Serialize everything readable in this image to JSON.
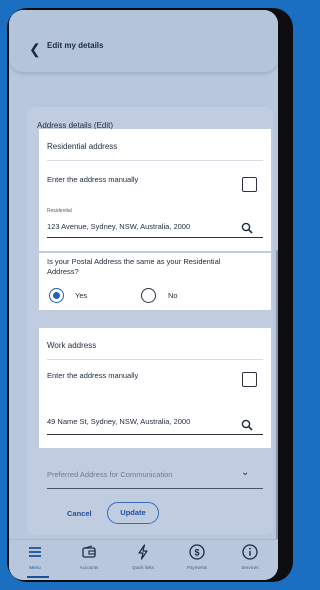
{
  "header": {
    "back_icon": "chevron-left-icon",
    "title": "Edit my details"
  },
  "section_title": "Address details (Edit)",
  "residential": {
    "title": "Residential address",
    "manual_label": "Enter the address manually",
    "field_label": "Residential",
    "value": "123 Avenue, Sydney, NSW, Australia, 2000"
  },
  "postal": {
    "question": "Is your Postal Address the same as your Residential Address?",
    "yes": "Yes",
    "no": "No",
    "selected": "Yes"
  },
  "work": {
    "title": "Work address",
    "manual_label": "Enter the address manually",
    "value": "49 Name St, Sydney, NSW, Australia, 2000"
  },
  "preferred": {
    "placeholder": "Preferred Address for Communication"
  },
  "actions": {
    "cancel": "Cancel",
    "update": "Update"
  },
  "nav": [
    {
      "label": "Menu",
      "icon": "menu-icon",
      "active": true
    },
    {
      "label": "Accounts",
      "icon": "wallet-icon"
    },
    {
      "label": "Quick links",
      "icon": "lightning-icon"
    },
    {
      "label": "Payments",
      "icon": "dollar-circle-icon"
    },
    {
      "label": "Services",
      "icon": "info-circle-icon"
    }
  ],
  "colors": {
    "accent": "#1f4e9a",
    "radio_selected": "#1f5fbf",
    "background": "#1a6fc0",
    "screen_overlay": "#b8c7dc"
  }
}
